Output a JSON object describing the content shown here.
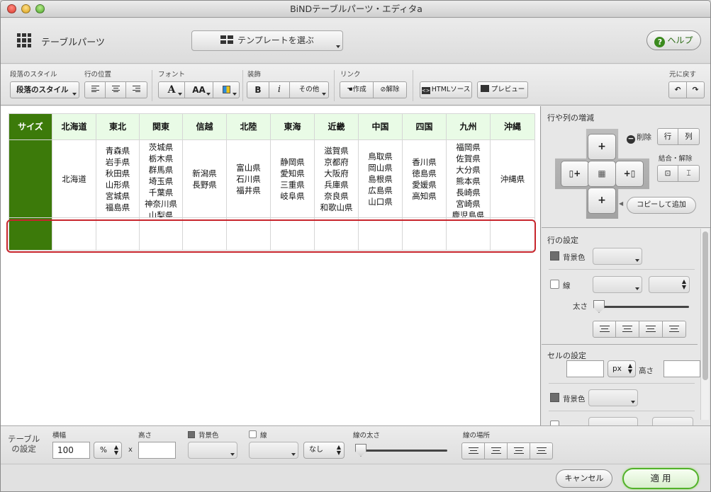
{
  "window": {
    "title": "BiNDテーブルパーツ・エディタa"
  },
  "header": {
    "title": "テーブルパーツ",
    "template_button": "テンプレートを選ぶ",
    "help_button": "ヘルプ"
  },
  "toolbar": {
    "para_style_label": "段落のスタイル",
    "para_style_value": "段落のスタイル",
    "row_pos_label": "行の位置",
    "font_label": "フォント",
    "font_a": "A",
    "font_aa": "AA",
    "deco_label": "装飾",
    "bold": "B",
    "italic": "i",
    "other": "その他",
    "link_label": "リンク",
    "link_create": "作成",
    "link_remove": "解除",
    "html_source": "HTMLソース",
    "preview": "プレビュー",
    "undo_label": "元に戻す"
  },
  "table": {
    "headers": [
      "サイズ",
      "北海道",
      "東北",
      "関東",
      "信越",
      "北陸",
      "東海",
      "近畿",
      "中国",
      "四国",
      "九州",
      "沖縄"
    ],
    "cells": [
      "",
      "北海道",
      "青森県\n岩手県\n秋田県\n山形県\n宮城県\n福島県",
      "茨城県\n栃木県\n群馬県\n埼玉県\n千葉県\n神奈川県\n山梨県",
      "新潟県\n長野県",
      "富山県\n石川県\n福井県",
      "静岡県\n愛知県\n三重県\n岐阜県",
      "滋賀県\n京都府\n大阪府\n兵庫県\n奈良県\n和歌山県",
      "鳥取県\n岡山県\n島根県\n広島県\n山口県",
      "香川県\n徳島県\n愛媛県\n高知県",
      "福岡県\n佐賀県\n大分県\n熊本県\n長崎県\n宮崎県\n鹿児島県",
      "沖縄県"
    ]
  },
  "right_panel": {
    "rowcol_title": "行や列の増減",
    "delete_label": "削除",
    "delete_row": "行",
    "delete_col": "列",
    "merge_label": "結合・解除",
    "copy_add": "コピーして追加",
    "row_settings": "行の設定",
    "bg_color": "背景色",
    "border": "線",
    "thickness": "太さ",
    "cell_settings": "セルの設定",
    "cell_width_unit": "px",
    "height_label": "高さ"
  },
  "bottom": {
    "table_settings_line1": "テーブル",
    "table_settings_line2": "の設定",
    "width_label": "横幅",
    "width_value": "100",
    "width_unit": "%",
    "x": "x",
    "height_label": "高さ",
    "bg_color": "背景色",
    "border": "線",
    "border_style": "なし",
    "border_thickness": "線の太さ",
    "border_place": "線の場所"
  },
  "footer": {
    "cancel": "キャンセル",
    "apply": "適 用"
  },
  "colors": {
    "accent_green": "#3c7a0a",
    "header_green": "#e9fbe6",
    "selection_red": "#c7252c"
  }
}
